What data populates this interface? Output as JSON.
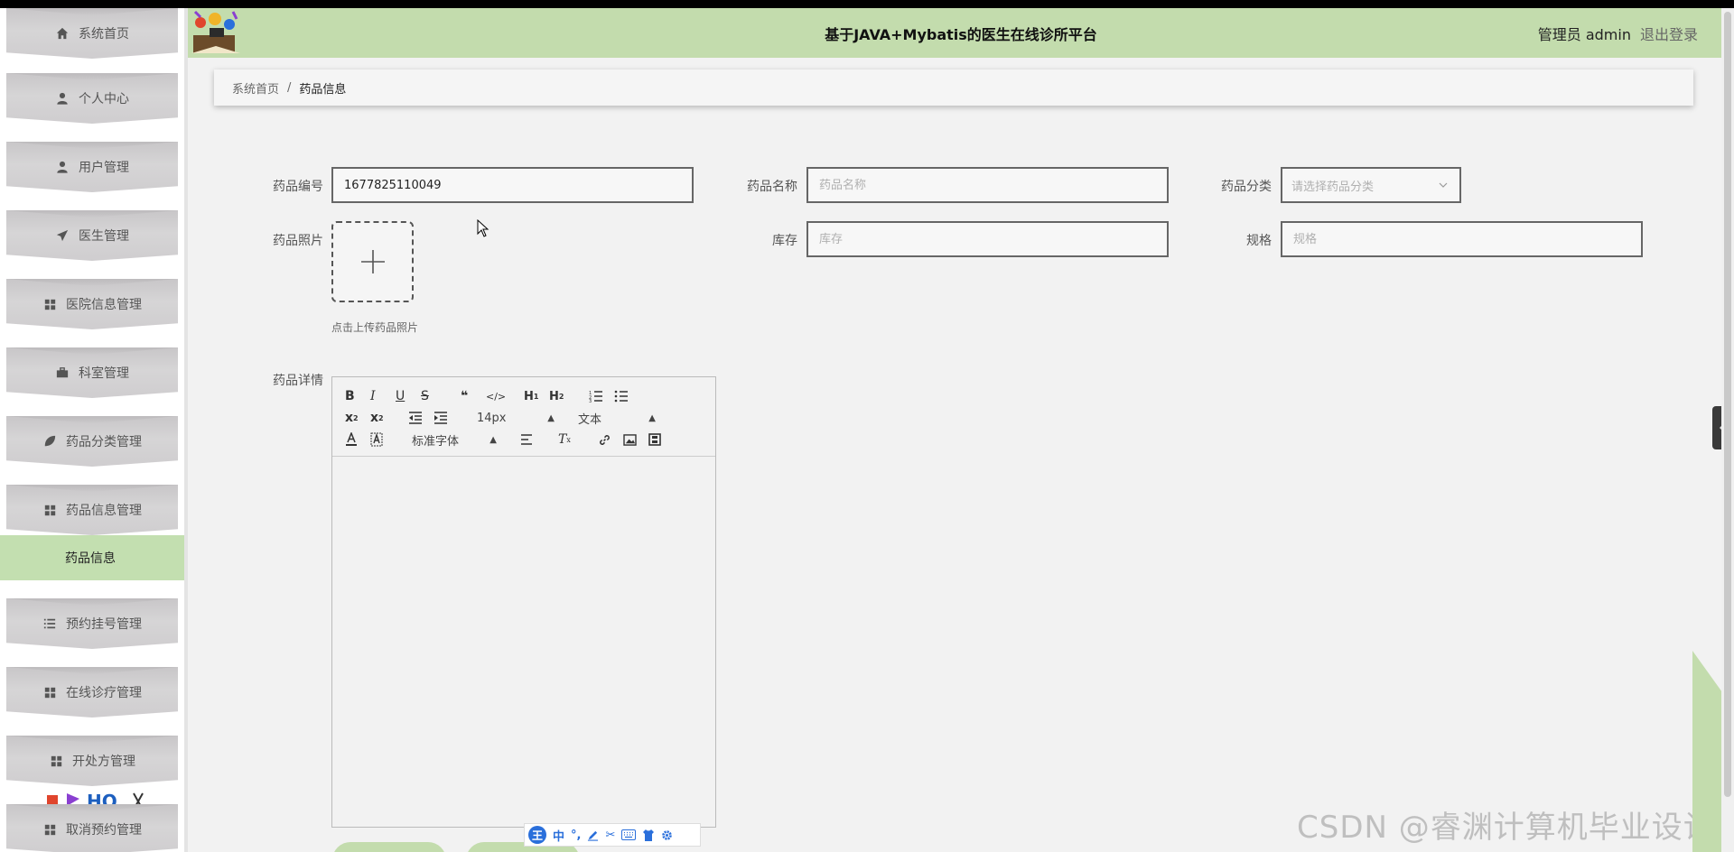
{
  "header": {
    "title": "基于JAVA+Mybatis的医生在线诊所平台",
    "user": "管理员 admin",
    "logout": "退出登录"
  },
  "breadcrumb": {
    "home": "系统首页",
    "separator": "/",
    "current": "药品信息"
  },
  "sidebar": {
    "items": [
      {
        "label": "系统首页",
        "icon": "home-icon"
      },
      {
        "label": "个人中心",
        "icon": "user-icon"
      },
      {
        "label": "用户管理",
        "icon": "user-icon"
      },
      {
        "label": "医生管理",
        "icon": "send-icon"
      },
      {
        "label": "医院信息管理",
        "icon": "grid-icon"
      },
      {
        "label": "科室管理",
        "icon": "briefcase-icon"
      },
      {
        "label": "药品分类管理",
        "icon": "leaf-icon"
      },
      {
        "label": "药品信息管理",
        "icon": "grid-icon"
      },
      {
        "label": "预约挂号管理",
        "icon": "list-icon"
      },
      {
        "label": "在线诊疗管理",
        "icon": "grid-icon"
      },
      {
        "label": "开处方管理",
        "icon": "grid-icon"
      },
      {
        "label": "取消预约管理",
        "icon": "grid-icon"
      }
    ],
    "active_sub": "药品信息"
  },
  "form": {
    "code_label": "药品编号",
    "code_value": "1677825110049",
    "name_label": "药品名称",
    "name_placeholder": "药品名称",
    "category_label": "药品分类",
    "category_placeholder": "请选择药品分类",
    "photo_label": "药品照片",
    "photo_tip": "点击上传药品照片",
    "stock_label": "库存",
    "stock_placeholder": "库存",
    "spec_label": "规格",
    "spec_placeholder": "规格",
    "detail_label": "药品详情"
  },
  "editor": {
    "font_size": "14px",
    "paragraph": "文本",
    "font_family": "标准字体"
  },
  "ime": {
    "logo": "王",
    "lang": "中"
  },
  "watermark": "CSDN @睿渊计算机毕业设计",
  "colors": {
    "header_bg": "#c3dcad",
    "active_menu_bg": "#c3dfb0",
    "page_bg": "#f2f2f2"
  }
}
